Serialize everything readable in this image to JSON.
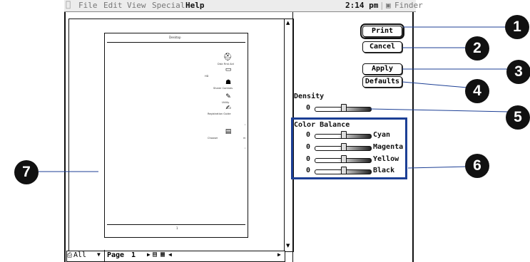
{
  "menubar": {
    "items": [
      "File",
      "Edit",
      "View",
      "Special",
      "Help"
    ],
    "clock": "2:14 pm",
    "app": "Finder"
  },
  "preview": {
    "page_header": "Desktop",
    "popup_all": "All",
    "page_label": "Page",
    "page_number": "1",
    "desktop_icons": [
      {
        "label": "Disk First Aid",
        "glyph": "⛑"
      },
      {
        "label": "HD",
        "glyph": "▭"
      },
      {
        "label": "Sharer Controls",
        "glyph": "☗"
      },
      {
        "label": "Utility",
        "glyph": "✎"
      },
      {
        "label": "Registration Guide",
        "glyph": "✍"
      },
      {
        "label": "Chooser",
        "glyph": "▤"
      }
    ]
  },
  "buttons": {
    "print": "Print",
    "cancel": "Cancel",
    "apply": "Apply",
    "defaults": "Defaults"
  },
  "density": {
    "label": "Density",
    "value": "0"
  },
  "color_balance": {
    "title": "Color Balance",
    "channels": [
      {
        "name": "Cyan",
        "value": "0"
      },
      {
        "name": "Magenta",
        "value": "0"
      },
      {
        "name": "Yellow",
        "value": "0"
      },
      {
        "name": "Black",
        "value": "0"
      }
    ]
  },
  "callouts": [
    "1",
    "2",
    "3",
    "4",
    "5",
    "6",
    "7"
  ],
  "colors": {
    "callout_line": "#1c3f95",
    "callout_fill": "#111111"
  }
}
